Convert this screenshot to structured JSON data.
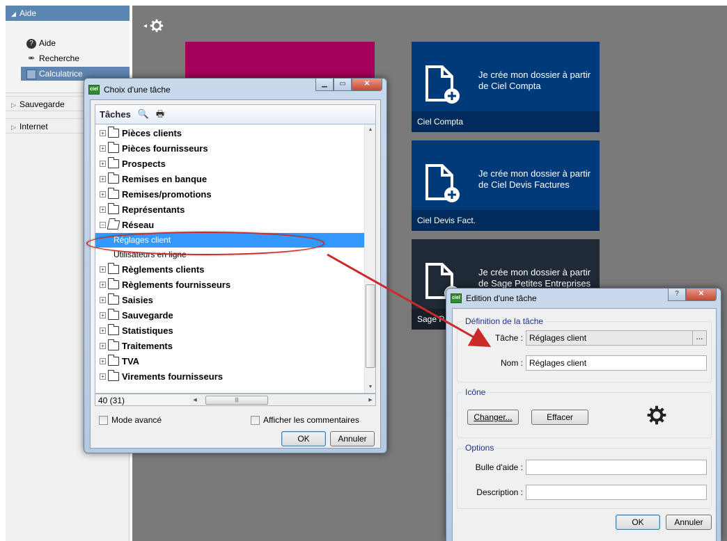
{
  "sidebar": {
    "aide": {
      "header": "Aide",
      "items": [
        {
          "label": "Aide",
          "icon": "help-icon"
        },
        {
          "label": "Recherche",
          "icon": "binoculars-icon"
        },
        {
          "label": "Calculatrice",
          "icon": "calculator-icon"
        }
      ]
    },
    "sauvegarde": "Sauvegarde",
    "internet": "Internet"
  },
  "tiles": [
    {
      "text": "Je crée mon dossier à partir de Ciel Compta",
      "footer": "Ciel Compta",
      "color": "#003a78"
    },
    {
      "text": "Je crée mon dossier à partir de Ciel Devis Factures",
      "footer": "Ciel Devis Fact.",
      "color": "#003a78"
    },
    {
      "text": "Je crée mon dossier à partir de Sage Petites Entreprises",
      "footer": "Sage P",
      "color": "#1f2a36"
    }
  ],
  "pink_tile_color": "#a5005a",
  "choix_dialog": {
    "title": "Choix d'une tâche",
    "toolbar_label": "Tâches",
    "tree": [
      "Pièces clients",
      "Pièces fournisseurs",
      "Prospects",
      "Remises en banque",
      "Remises/promotions",
      "Représentants",
      "Réseau",
      "Réglages client",
      "Utilisateurs en ligne",
      "Règlements clients",
      "Règlements fournisseurs",
      "Saisies",
      "Sauvegarde",
      "Statistiques",
      "Traitements",
      "TVA",
      "Virements fournisseurs"
    ],
    "count": "40 (31)",
    "mode_avance": "Mode avancé",
    "afficher_commentaires": "Afficher les commentaires",
    "ok": "OK",
    "annuler": "Annuler"
  },
  "edit_dialog": {
    "title": "Edition d'une tâche",
    "definition_group": "Définition de la tâche",
    "tache_label": "Tâche :",
    "tache_value": "Réglages client",
    "browse": "...",
    "nom_label": "Nom :",
    "nom_value": "Réglages client",
    "icone_group": "Icône",
    "changer": "Changer...",
    "effacer": "Effacer",
    "options_group": "Options",
    "bulle_label": "Bulle d'aide :",
    "description_label": "Description :",
    "ok": "OK",
    "annuler": "Annuler"
  },
  "highlight_color": "#cc2a2a",
  "selection_color": "#3399ff"
}
